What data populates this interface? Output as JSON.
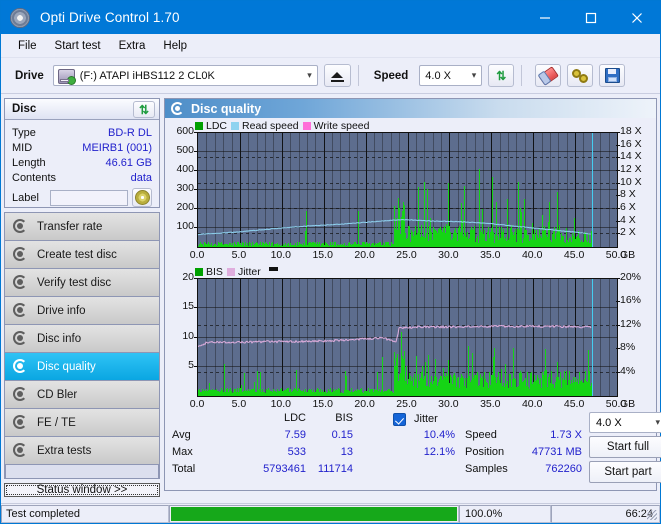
{
  "window": {
    "title": "Opti Drive Control 1.70",
    "icon": "disc-icon",
    "minimize": "—",
    "maximize": "□",
    "close": "✕"
  },
  "menu": [
    {
      "label": "File"
    },
    {
      "label": "Start test"
    },
    {
      "label": "Extra"
    },
    {
      "label": "Help"
    }
  ],
  "toolbar": {
    "drive_label": "Drive",
    "drive_value": "(F:)  ATAPI iHBS112  2 CL0K",
    "eject_icon": "eject-icon",
    "speed_label": "Speed",
    "speed_value": "4.0 X",
    "refresh_icon": "refresh-icon",
    "eraser_icon": "eraser-icon",
    "gears_icon": "gears-icon",
    "save_icon": "floppy-save-icon"
  },
  "disc_panel": {
    "title": "Disc",
    "refresh_icon": "refresh-icon",
    "rows": [
      {
        "key": "Type",
        "value": "BD-R DL"
      },
      {
        "key": "MID",
        "value": "MEIRB1 (001)"
      },
      {
        "key": "Length",
        "value": "46.61 GB"
      },
      {
        "key": "Contents",
        "value": "data"
      }
    ],
    "label_key": "Label",
    "label_value": "",
    "label_placeholder": "",
    "cd_icon": "cd-disc-icon"
  },
  "nav": {
    "items": [
      {
        "label": "Transfer rate",
        "selected": false
      },
      {
        "label": "Create test disc",
        "selected": false
      },
      {
        "label": "Verify test disc",
        "selected": false
      },
      {
        "label": "Drive info",
        "selected": false
      },
      {
        "label": "Disc info",
        "selected": false
      },
      {
        "label": "Disc quality",
        "selected": true
      },
      {
        "label": "CD Bler",
        "selected": false
      },
      {
        "label": "FE / TE",
        "selected": false
      },
      {
        "label": "Extra tests",
        "selected": false
      }
    ],
    "status_button": "Status window >>"
  },
  "content": {
    "header_title": "Disc quality",
    "header_icon": "disc-quality-icon"
  },
  "chart_data": [
    {
      "type": "bar",
      "id": "ldc-chart",
      "title": "",
      "legend": [
        {
          "label": "LDC",
          "color": "#00a000"
        },
        {
          "label": "Read speed",
          "color": "#8fd3f0"
        },
        {
          "label": "Write speed",
          "color": "#ff6fd8"
        }
      ],
      "legend_position": "top-left",
      "xlabel": "GB",
      "ylabel": "",
      "y2label": "X",
      "xlim": [
        0,
        50
      ],
      "ylim": [
        0,
        600
      ],
      "y2lim": [
        0,
        18
      ],
      "xticks": [
        "0.0",
        "5.0",
        "10.0",
        "15.0",
        "20.0",
        "25.0",
        "30.0",
        "35.0",
        "40.0",
        "45.0",
        "50.0"
      ],
      "yticks": [
        100,
        200,
        300,
        400,
        500,
        600
      ],
      "y2ticks": [
        "2 X",
        "4 X",
        "6 X",
        "8 X",
        "10 X",
        "12 X",
        "14 X",
        "16 X",
        "18 X"
      ],
      "grid": true,
      "cursor_x": 47.0,
      "series": [
        {
          "name": "LDC",
          "type": "bar",
          "color": "#15d415",
          "x_range": [
            0,
            47
          ],
          "typical": 7.59,
          "max": 533,
          "note": "dense green error spikes across 0-47 GB, baseline ~5-40, frequent spikes 100-350, cluster of tall spikes 23.5-24.5 GB reaching 533"
        },
        {
          "name": "Read speed",
          "type": "line",
          "color": "#8fd3f0",
          "axis": "y2",
          "points": [
            [
              0,
              2.0
            ],
            [
              5,
              2.4
            ],
            [
              10,
              3.0
            ],
            [
              13,
              3.3
            ],
            [
              17,
              3.6
            ],
            [
              20,
              3.9
            ],
            [
              23,
              4.2
            ],
            [
              24,
              4.3
            ],
            [
              25,
              4.3
            ],
            [
              28,
              4.1
            ],
            [
              31,
              4.0
            ],
            [
              34,
              3.8
            ],
            [
              37,
              3.4
            ],
            [
              40,
              3.0
            ],
            [
              43,
              2.6
            ],
            [
              46,
              2.2
            ],
            [
              47,
              2.0
            ]
          ]
        },
        {
          "name": "Write speed",
          "type": "line",
          "color": "#ff6fd8",
          "axis": "y2",
          "points": []
        }
      ]
    },
    {
      "type": "bar",
      "id": "bis-chart",
      "title": "",
      "legend": [
        {
          "label": "BIS",
          "color": "#00a000"
        },
        {
          "label": "Jitter",
          "color": "#e0aede"
        }
      ],
      "legend_position": "top-left",
      "xlabel": "GB",
      "ylabel": "",
      "y2label": "%",
      "xlim": [
        0,
        50
      ],
      "ylim": [
        0,
        20
      ],
      "y2lim": [
        0,
        20
      ],
      "xticks": [
        "0.0",
        "5.0",
        "10.0",
        "15.0",
        "20.0",
        "25.0",
        "30.0",
        "35.0",
        "40.0",
        "45.0",
        "50.0"
      ],
      "yticks": [
        5,
        10,
        15,
        20
      ],
      "y2ticks": [
        "4%",
        "8%",
        "12%",
        "16%",
        "20%"
      ],
      "grid": true,
      "cursor_x": 47.0,
      "series": [
        {
          "name": "BIS",
          "type": "bar",
          "color": "#15d415",
          "x_range": [
            0,
            47
          ],
          "typical": 0.15,
          "max": 13,
          "note": "low green bars mostly under 1 for 0-23 GB, rising to 2-8 after 24 GB with occasional spikes to 13"
        },
        {
          "name": "Jitter",
          "type": "line",
          "color": "#e0aede",
          "axis": "y2",
          "points": [
            [
              0,
              8.4
            ],
            [
              1,
              9.1
            ],
            [
              3,
              9.2
            ],
            [
              6,
              9.2
            ],
            [
              9,
              9.3
            ],
            [
              12,
              9.3
            ],
            [
              15,
              9.4
            ],
            [
              18,
              9.6
            ],
            [
              20,
              9.8
            ],
            [
              22,
              9.9
            ],
            [
              23,
              9.6
            ],
            [
              23.6,
              9.0
            ],
            [
              24,
              11.6
            ],
            [
              26,
              11.8
            ],
            [
              30,
              11.8
            ],
            [
              34,
              11.9
            ],
            [
              38,
              11.9
            ],
            [
              42,
              11.9
            ],
            [
              46,
              11.8
            ],
            [
              47,
              11.8
            ]
          ]
        }
      ]
    }
  ],
  "stats": {
    "col_headers": [
      "LDC",
      "BIS"
    ],
    "rows": [
      {
        "label": "Avg",
        "ldc": "7.59",
        "bis": "0.15"
      },
      {
        "label": "Max",
        "ldc": "533",
        "bis": "13"
      },
      {
        "label": "Total",
        "ldc": "5793461",
        "bis": "111714"
      }
    ],
    "jitter": {
      "checkbox_checked": true,
      "label": "Jitter",
      "avg": "10.4%",
      "max": "12.1%"
    },
    "right": [
      {
        "label": "Speed",
        "value": "1.73 X"
      },
      {
        "label": "Position",
        "value": "47731 MB"
      },
      {
        "label": "Samples",
        "value": "762260"
      }
    ],
    "speed_select": "4.0 X",
    "start_full": "Start full",
    "start_part": "Start part"
  },
  "statusbar": {
    "message": "Test completed",
    "progress_percent": "100.0%",
    "progress_value": 100,
    "elapsed": "66:24"
  }
}
